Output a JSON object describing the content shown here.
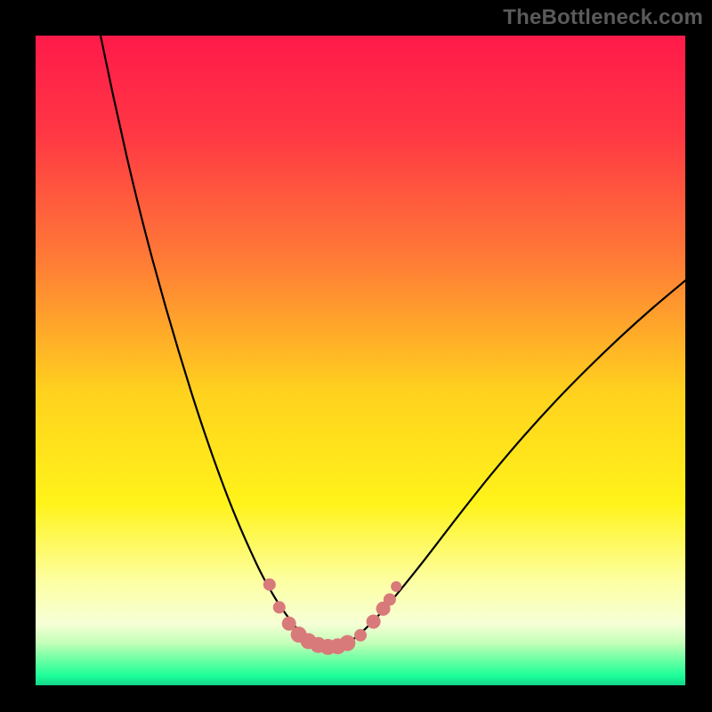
{
  "watermark": "TheBottleneck.com",
  "chart_data": {
    "type": "line",
    "title": "",
    "xlabel": "",
    "ylabel": "",
    "xlim": [
      0,
      100
    ],
    "ylim": [
      0,
      100
    ],
    "grid": false,
    "legend": false,
    "background_gradient": {
      "stops": [
        {
          "offset": 0.0,
          "color": "#ff1a4a"
        },
        {
          "offset": 0.15,
          "color": "#ff3744"
        },
        {
          "offset": 0.35,
          "color": "#ff7d36"
        },
        {
          "offset": 0.55,
          "color": "#ffd21e"
        },
        {
          "offset": 0.72,
          "color": "#fff31a"
        },
        {
          "offset": 0.84,
          "color": "#fdffa2"
        },
        {
          "offset": 0.905,
          "color": "#f6ffd6"
        },
        {
          "offset": 0.935,
          "color": "#c4ffb8"
        },
        {
          "offset": 0.96,
          "color": "#6effa4"
        },
        {
          "offset": 0.985,
          "color": "#1eff99"
        },
        {
          "offset": 1.0,
          "color": "#12d48a"
        }
      ]
    },
    "series": [
      {
        "name": "bottleneck-curve",
        "stroke": "#000000",
        "stroke_width": 2.2,
        "x": [
          10,
          12,
          14,
          16,
          18,
          20,
          22,
          24,
          26,
          28,
          30,
          32,
          34,
          35,
          36,
          37,
          38,
          39,
          40,
          41,
          42,
          43,
          44,
          45,
          46,
          48,
          50,
          53,
          56,
          60,
          65,
          70,
          75,
          80,
          85,
          90,
          95,
          100
        ],
        "y": [
          100,
          90.5,
          81.5,
          73.2,
          65.5,
          58.3,
          51.5,
          45.0,
          38.9,
          33.2,
          27.9,
          23.1,
          18.7,
          16.7,
          14.9,
          13.2,
          11.7,
          10.3,
          9.0,
          7.9,
          7.1,
          6.5,
          6.1,
          5.9,
          5.9,
          6.5,
          8.0,
          11.0,
          14.5,
          19.5,
          26.0,
          32.3,
          38.2,
          43.7,
          48.8,
          53.6,
          58.1,
          62.3
        ]
      }
    ],
    "markers": {
      "name": "point-cluster",
      "fill": "#d97a7a",
      "stroke": "none",
      "points": [
        {
          "x": 36.0,
          "y": 15.5,
          "r": 7
        },
        {
          "x": 37.5,
          "y": 12.0,
          "r": 7
        },
        {
          "x": 39.0,
          "y": 9.5,
          "r": 8
        },
        {
          "x": 40.5,
          "y": 7.8,
          "r": 9
        },
        {
          "x": 42.0,
          "y": 6.8,
          "r": 9
        },
        {
          "x": 43.5,
          "y": 6.2,
          "r": 9
        },
        {
          "x": 45.0,
          "y": 5.9,
          "r": 9
        },
        {
          "x": 46.5,
          "y": 6.0,
          "r": 9
        },
        {
          "x": 48.0,
          "y": 6.5,
          "r": 9
        },
        {
          "x": 50.0,
          "y": 7.7,
          "r": 7
        },
        {
          "x": 52.0,
          "y": 9.8,
          "r": 8
        },
        {
          "x": 53.5,
          "y": 11.8,
          "r": 8
        },
        {
          "x": 54.5,
          "y": 13.2,
          "r": 7
        },
        {
          "x": 55.5,
          "y": 15.2,
          "r": 6
        }
      ]
    }
  }
}
